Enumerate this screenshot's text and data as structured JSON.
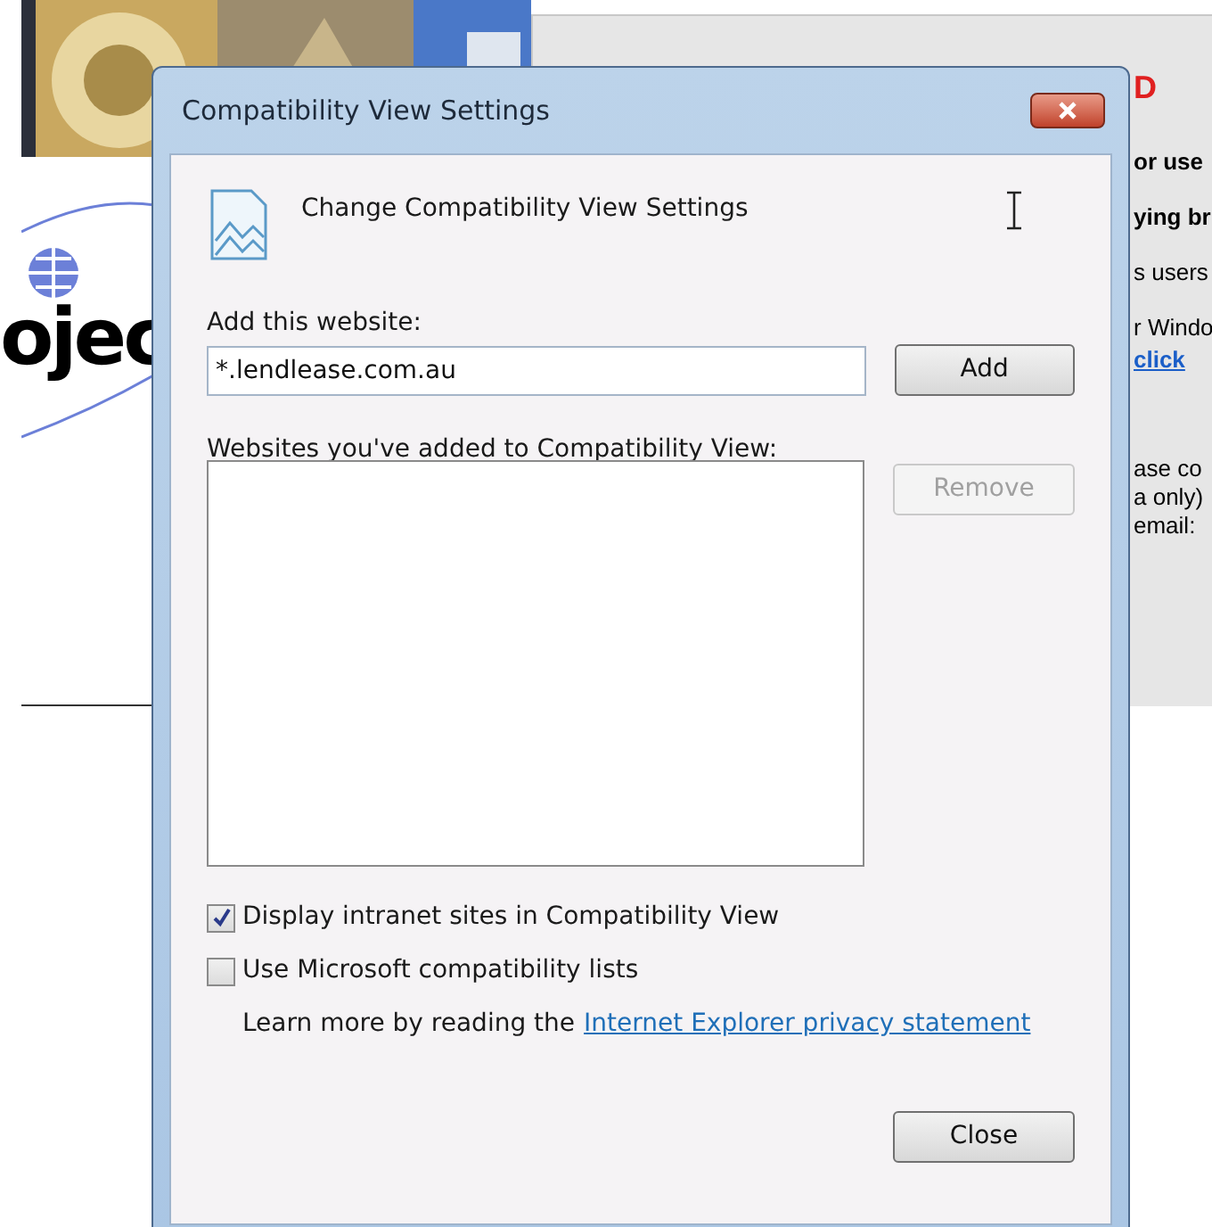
{
  "background": {
    "logo_text": "ojec",
    "heading": "D",
    "lines": [
      "or use",
      "ying br",
      "s users",
      "r Windo"
    ],
    "link": "click",
    "lines_2": [
      "ase co",
      "a only)",
      "email:"
    ]
  },
  "dialog": {
    "title": "Compatibility View Settings",
    "heading": "Change Compatibility View Settings",
    "add_label": "Add this website:",
    "add_value": "*.lendlease.com.au",
    "add_button": {
      "label": "Add",
      "disabled": false
    },
    "list_label": "Websites you've added to Compatibility View:",
    "remove_button": {
      "label": "Remove",
      "disabled": true
    },
    "options": [
      {
        "label": "Display intranet sites in Compatibility View",
        "checked": true
      },
      {
        "label": "Use Microsoft compatibility lists",
        "checked": false
      }
    ],
    "learn_more": "Learn more by reading the",
    "privacy_link": "Internet Explorer privacy statement",
    "close_button": {
      "label": "Close",
      "disabled": false
    }
  }
}
